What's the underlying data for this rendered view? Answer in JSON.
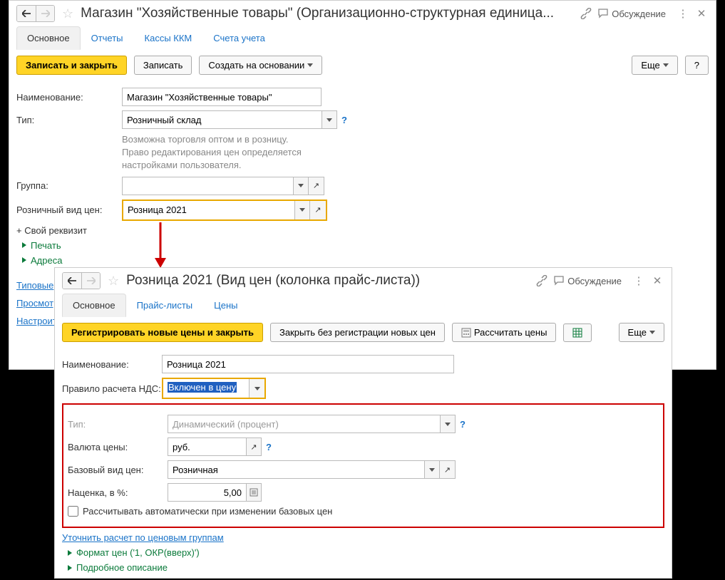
{
  "win1": {
    "title": "Магазин \"Хозяйственные товары\" (Организационно-структурная единица...",
    "discuss": "Обсуждение",
    "tabs": {
      "main": "Основное",
      "reports": "Отчеты",
      "kkm": "Кассы ККМ",
      "accounts": "Счета учета"
    },
    "toolbar": {
      "save_close": "Записать и закрыть",
      "save": "Записать",
      "create_based": "Создать на основании",
      "more": "Еще"
    },
    "fields": {
      "name_label": "Наименование:",
      "name_value": "Магазин \"Хозяйственные товары\"",
      "type_label": "Тип:",
      "type_value": "Розничный склад",
      "type_hint": "Возможна торговля оптом и в розницу.\nПраво редактирования цен определяется\nнастройками пользователя.",
      "group_label": "Группа:",
      "group_value": "",
      "retail_price_label": "Розничный вид цен:",
      "retail_price_value": "Розница 2021",
      "own_attr": "+ Свой реквизит"
    },
    "tree": {
      "print": "Печать",
      "addresses": "Адреса"
    },
    "links": {
      "typical": "Типовые",
      "view": "Просмотр",
      "configure": "Настроить"
    }
  },
  "win2": {
    "title": "Розница 2021 (Вид цен (колонка прайс-листа))",
    "discuss": "Обсуждение",
    "tabs": {
      "main": "Основное",
      "pricelists": "Прайс-листы",
      "prices": "Цены"
    },
    "toolbar": {
      "reg_close": "Регистрировать новые цены и закрыть",
      "close_noreg": "Закрыть без регистрации новых цен",
      "calc": "Рассчитать цены",
      "more": "Еще"
    },
    "fields": {
      "name_label": "Наименование:",
      "name_value": "Розница 2021",
      "vat_label": "Правило расчета НДС:",
      "vat_value": "Включен в цену",
      "type_label": "Тип:",
      "type_value": "Динамический (процент)",
      "currency_label": "Валюта цены:",
      "currency_value": "руб.",
      "base_label": "Базовый вид цен:",
      "base_value": "Розничная",
      "markup_label": "Наценка, в %:",
      "markup_value": "5,00",
      "auto_calc": "Рассчитывать автоматически при изменении базовых цен"
    },
    "links": {
      "refine": "Уточнить расчет по ценовым группам",
      "format": "Формат цен ('1, ОКР(вверх)')",
      "details": "Подробное описание"
    }
  }
}
